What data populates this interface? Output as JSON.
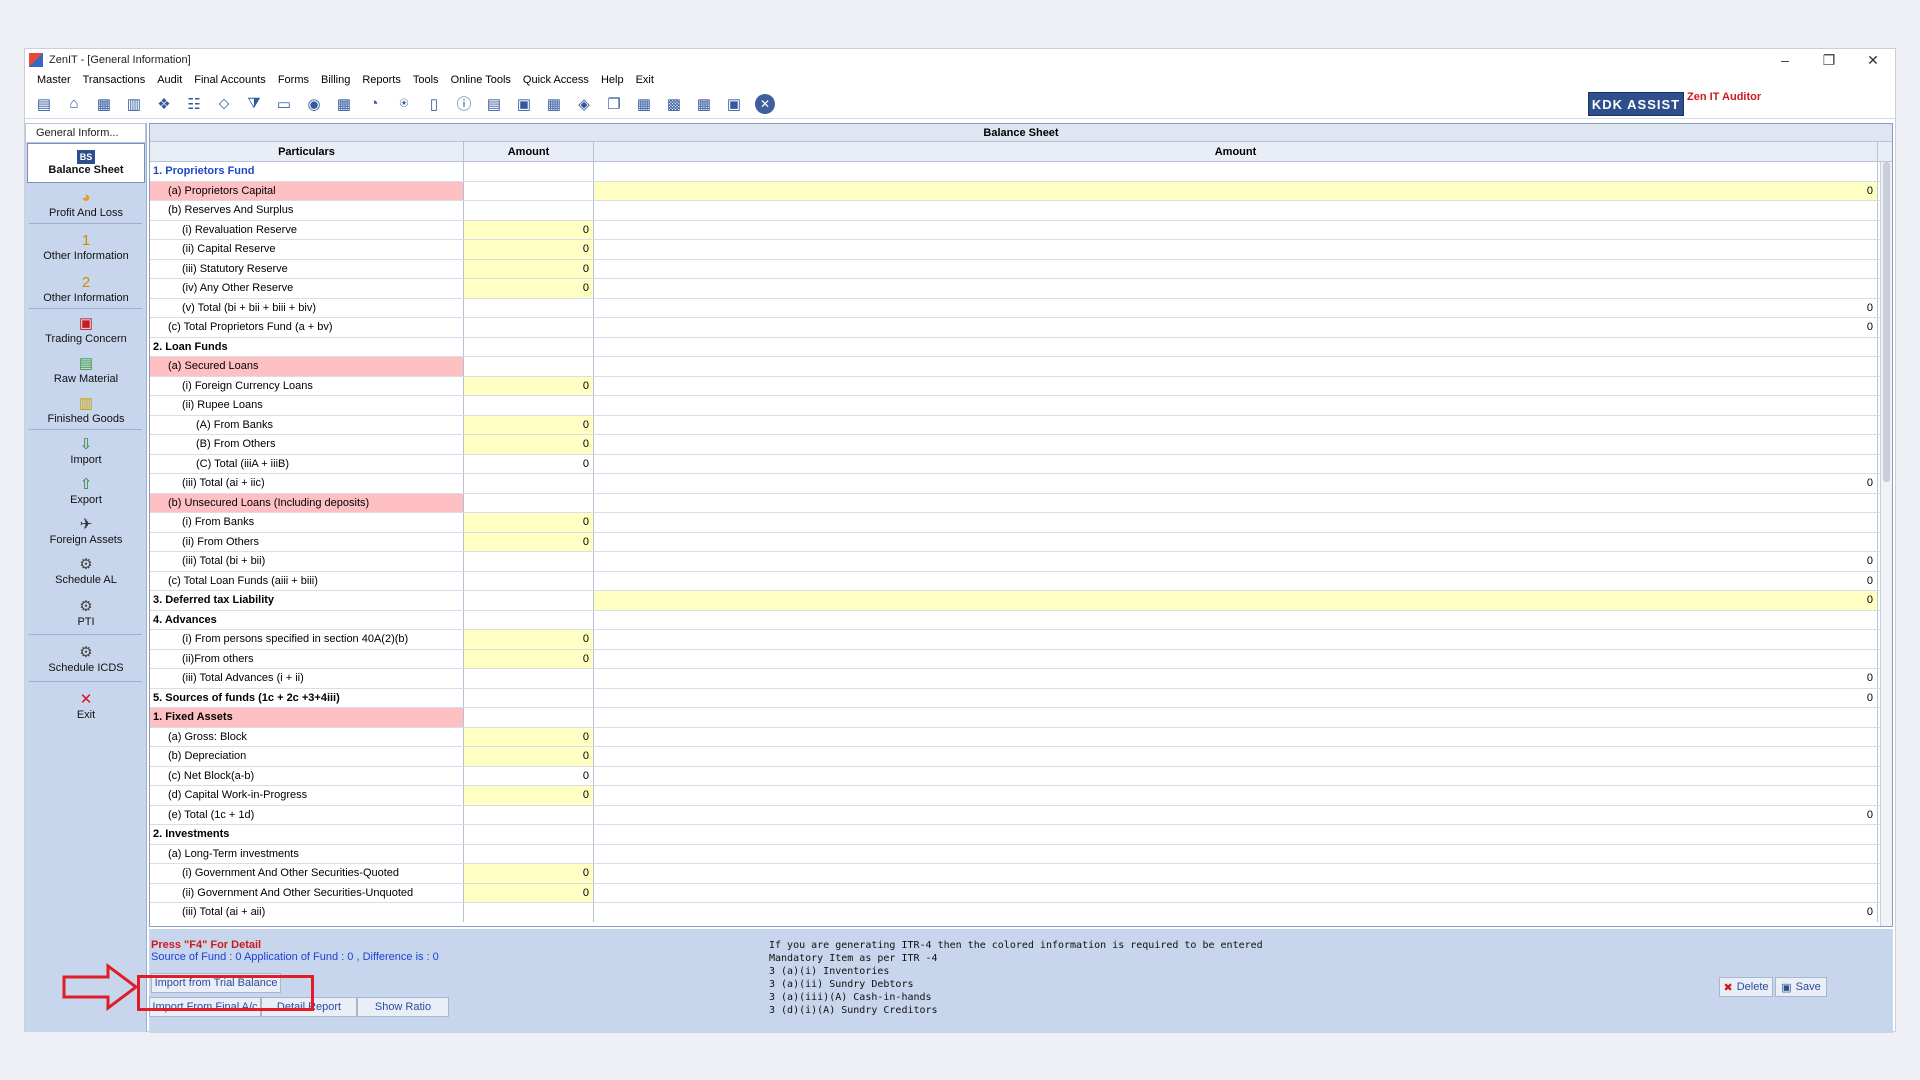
{
  "window": {
    "title": "ZenIT - [General Information]",
    "controls": [
      "–",
      "❐",
      "✕"
    ]
  },
  "menu": [
    "Master",
    "Transactions",
    "Audit",
    "Final Accounts",
    "Forms",
    "Billing",
    "Reports",
    "Tools",
    "Online Tools",
    "Quick Access",
    "Help",
    "Exit"
  ],
  "toolbar": {
    "icons": [
      "new-doc-icon",
      "home-icon",
      "building-icon",
      "chart-icon",
      "gift-icon",
      "users-icon",
      "tag-icon",
      "filter-icon",
      "tax-icon",
      "refresh-icon",
      "calculator-icon",
      "pie-icon",
      "pay-icon",
      "book-icon",
      "info-icon",
      "report-icon",
      "doc-search-icon",
      "calendar-icon",
      "folder-icon",
      "copy-icon",
      "bs-icon",
      "people-icon",
      "icd-icon",
      "export-icon"
    ],
    "kdk_assist": "KDK ASSIST",
    "zen_auditor": "Zen IT Auditor"
  },
  "sidebar": {
    "tab": "General Inform...",
    "items": [
      {
        "label": "Balance Sheet",
        "icon": "balance-sheet-icon",
        "glyph": "BS",
        "active": true
      },
      {
        "label": "Profit And Loss",
        "icon": "profit-loss-icon",
        "glyph": "◕"
      },
      {
        "label": "Other Information",
        "icon": "number-one-icon",
        "glyph": "1"
      },
      {
        "label": "Other Information",
        "icon": "number-two-icon",
        "glyph": "2"
      },
      {
        "label": "Trading Concern",
        "icon": "trading-icon",
        "glyph": "▣"
      },
      {
        "label": "Raw Material",
        "icon": "raw-material-icon",
        "glyph": "▤"
      },
      {
        "label": "Finished Goods",
        "icon": "finished-goods-icon",
        "glyph": "▥"
      },
      {
        "label": "Import",
        "icon": "import-icon",
        "glyph": "⇩"
      },
      {
        "label": "Export",
        "icon": "export-icon",
        "glyph": "⇧"
      },
      {
        "label": "Foreign Assets",
        "icon": "airplane-icon",
        "glyph": "✈"
      },
      {
        "label": "Schedule AL",
        "icon": "gear-icon",
        "glyph": "⚙"
      },
      {
        "label": "PTI",
        "icon": "gear-icon",
        "glyph": "⚙"
      },
      {
        "label": "Schedule ICDS",
        "icon": "gear-icon",
        "glyph": "⚙"
      },
      {
        "label": "Exit",
        "icon": "exit-icon",
        "glyph": "✕"
      }
    ]
  },
  "sheet": {
    "title": "Balance Sheet",
    "col_particulars": "Particulars",
    "col_amount1": "Amount",
    "col_amount2": "Amount",
    "rows": [
      {
        "label": "1. Proprietors Fund",
        "level": 0,
        "style": "blue-bold",
        "a1": "",
        "a2": "",
        "hl1": "",
        "hl2": ""
      },
      {
        "label": "(a) Proprietors Capital",
        "level": 1,
        "style": "",
        "a1": "",
        "a2": "0",
        "hl0": "head",
        "hl2": "in"
      },
      {
        "label": "(b) Reserves And Surplus",
        "level": 1,
        "style": "",
        "a1": "",
        "a2": ""
      },
      {
        "label": "(i) Revaluation Reserve",
        "level": 2,
        "style": "",
        "a1": "0",
        "a2": "",
        "hl1": "in"
      },
      {
        "label": "(ii) Capital Reserve",
        "level": 2,
        "style": "",
        "a1": "0",
        "a2": "",
        "hl1": "in"
      },
      {
        "label": "(iii) Statutory Reserve",
        "level": 2,
        "style": "",
        "a1": "0",
        "a2": "",
        "hl1": "in"
      },
      {
        "label": "(iv) Any Other Reserve",
        "level": 2,
        "style": "",
        "a1": "0",
        "a2": "",
        "hl1": "in"
      },
      {
        "label": "(v) Total (bi + bii + biii + biv)",
        "level": 2,
        "style": "",
        "a1": "",
        "a2": "0"
      },
      {
        "label": "(c) Total Proprietors Fund (a + bv)",
        "level": 1,
        "style": "",
        "a1": "",
        "a2": "0"
      },
      {
        "label": "2. Loan Funds",
        "level": 0,
        "style": "bold",
        "a1": "",
        "a2": ""
      },
      {
        "label": "(a) Secured Loans",
        "level": 1,
        "style": "",
        "a1": "",
        "a2": "",
        "hl0": "head"
      },
      {
        "label": "(i) Foreign Currency Loans",
        "level": 2,
        "style": "",
        "a1": "0",
        "a2": "",
        "hl1": "in"
      },
      {
        "label": "(ii) Rupee Loans",
        "level": 2,
        "style": "",
        "a1": "",
        "a2": ""
      },
      {
        "label": "(A) From Banks",
        "level": 3,
        "style": "",
        "a1": "0",
        "a2": "",
        "hl1": "in"
      },
      {
        "label": "(B) From Others",
        "level": 3,
        "style": "",
        "a1": "0",
        "a2": "",
        "hl1": "in"
      },
      {
        "label": "(C) Total (iiiA + iiiB)",
        "level": 3,
        "style": "",
        "a1": "0",
        "a2": ""
      },
      {
        "label": "(iii) Total (ai + iic)",
        "level": 2,
        "style": "",
        "a1": "",
        "a2": "0"
      },
      {
        "label": "(b) Unsecured Loans (Including deposits)",
        "level": 1,
        "style": "",
        "a1": "",
        "a2": "",
        "hl0": "head"
      },
      {
        "label": "(i) From Banks",
        "level": 2,
        "style": "",
        "a1": "0",
        "a2": "",
        "hl1": "in"
      },
      {
        "label": "(ii) From Others",
        "level": 2,
        "style": "",
        "a1": "0",
        "a2": "",
        "hl1": "in"
      },
      {
        "label": "(iii) Total (bi + bii)",
        "level": 2,
        "style": "",
        "a1": "",
        "a2": "0"
      },
      {
        "label": "(c) Total Loan Funds (aiii + biii)",
        "level": 1,
        "style": "",
        "a1": "",
        "a2": "0"
      },
      {
        "label": "3. Deferred tax Liability",
        "level": 0,
        "style": "bold",
        "a1": "",
        "a2": "0",
        "hl2": "in"
      },
      {
        "label": "4.  Advances",
        "level": 0,
        "style": "bold",
        "a1": "",
        "a2": ""
      },
      {
        "label": "(i) From persons specified in section 40A(2)(b)",
        "level": 2,
        "style": "",
        "a1": "0",
        "a2": "",
        "hl1": "in"
      },
      {
        "label": "(ii)From others",
        "level": 2,
        "style": "",
        "a1": "0",
        "a2": "",
        "hl1": "in"
      },
      {
        "label": "(iii) Total Advances (i + ii)",
        "level": 2,
        "style": "",
        "a1": "",
        "a2": "0"
      },
      {
        "label": "5. Sources of funds (1c + 2c +3+4iii)",
        "level": 0,
        "style": "bold",
        "a1": "",
        "a2": "0"
      },
      {
        "label": "1. Fixed Assets",
        "level": 0,
        "style": "bold",
        "a1": "",
        "a2": "",
        "hl0": "head"
      },
      {
        "label": "(a) Gross: Block",
        "level": 1,
        "style": "",
        "a1": "0",
        "a2": "",
        "hl1": "in"
      },
      {
        "label": "(b) Depreciation",
        "level": 1,
        "style": "",
        "a1": "0",
        "a2": "",
        "hl1": "in"
      },
      {
        "label": "(c) Net Block(a-b)",
        "level": 1,
        "style": "",
        "a1": "0",
        "a2": ""
      },
      {
        "label": "(d) Capital Work-in-Progress",
        "level": 1,
        "style": "",
        "a1": "0",
        "a2": "",
        "hl1": "in"
      },
      {
        "label": "(e) Total (1c + 1d)",
        "level": 1,
        "style": "",
        "a1": "",
        "a2": "0"
      },
      {
        "label": "2. Investments",
        "level": 0,
        "style": "bold",
        "a1": "",
        "a2": ""
      },
      {
        "label": "(a) Long-Term investments",
        "level": 1,
        "style": "",
        "a1": "",
        "a2": ""
      },
      {
        "label": "(i) Government And Other Securities-Quoted",
        "level": 2,
        "style": "",
        "a1": "0",
        "a2": "",
        "hl1": "in"
      },
      {
        "label": "(ii) Government And Other Securities-Unquoted",
        "level": 2,
        "style": "",
        "a1": "0",
        "a2": "",
        "hl1": "in"
      },
      {
        "label": "(iii) Total (ai + aii)",
        "level": 2,
        "style": "",
        "a1": "",
        "a2": "0"
      }
    ]
  },
  "footer": {
    "f4_hint": "Press \"F4\" For Detail",
    "fund_line": "Source of Fund : 0 Application of Fund : 0 , Difference is : 0",
    "itr_note": [
      "If you are generating ITR-4 then the colored information is required to be entered",
      "Mandatory Item as per ITR -4",
      "3 (a)(i) Inventories",
      "3 (a)(ii) Sundry Debtors",
      "3 (a)(iii)(A) Cash-in-hands",
      "3 (d)(i)(A) Sundry Creditors"
    ],
    "btn_trial": "Import from Trial Balance",
    "btn_final": "Import From Final A/c",
    "btn_detail": "Detail Report",
    "btn_ratio": "Show Ratio",
    "btn_delete": "Delete",
    "btn_save": "Save"
  },
  "colors": {
    "highlight_head": "#ffc0c4",
    "highlight_input": "#ffffc4",
    "annotation_red": "#e01d26",
    "panel_blue": "#c7d6ec"
  }
}
